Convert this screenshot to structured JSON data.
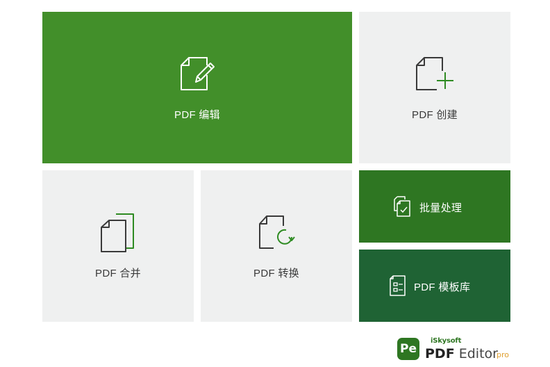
{
  "tiles": {
    "edit": {
      "label": "PDF 编辑",
      "icon": "pdf-edit-icon"
    },
    "create": {
      "label": "PDF 创建",
      "icon": "pdf-create-icon"
    },
    "merge": {
      "label": "PDF 合并",
      "icon": "pdf-merge-icon"
    },
    "convert": {
      "label": "PDF 转换",
      "icon": "pdf-convert-icon"
    },
    "batch": {
      "label": "批量处理",
      "icon": "batch-process-icon"
    },
    "templates": {
      "label": "PDF 模板库",
      "icon": "template-library-icon"
    }
  },
  "brand": {
    "badge": "Pe",
    "company": "iSkysoft",
    "product_pdf": "PDF",
    "product_editor": "Editor",
    "edition": "pro"
  },
  "colors": {
    "edit_tile": "#428f2a",
    "batch_tile": "#2e7622",
    "templates_tile": "#1f6334",
    "light_tile": "#eff0f0",
    "accent_green": "#2e8b22"
  }
}
